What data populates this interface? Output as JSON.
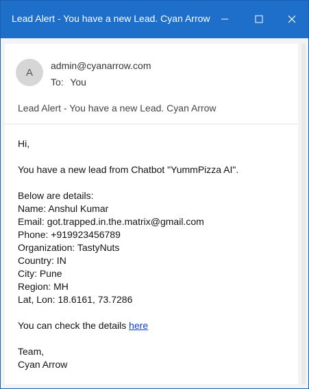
{
  "window": {
    "title": "Lead Alert - You have a new Lead. Cyan Arrow",
    "controls": [
      "minimize-icon",
      "maximize-icon",
      "close-icon"
    ],
    "accent_color": "#1e6fc9"
  },
  "header": {
    "avatar_initial": "A",
    "from": "admin@cyanarrow.com",
    "to_label": "To:",
    "to_value": "You",
    "subject": "Lead Alert - You have a new Lead. Cyan Arrow"
  },
  "body": {
    "greeting": "Hi,",
    "intro": "You have a new lead from Chatbot \"YummPizza AI\".",
    "details_heading": "Below are details:",
    "details": [
      "Name: Anshul Kumar",
      "Email: got.trapped.in.the.matrix@gmail.com",
      "Phone: +919923456789",
      "Organization: TastyNuts",
      "Country: IN",
      "City: Pune",
      "Region: MH",
      "Lat, Lon: 18.6161, 73.7286"
    ],
    "check_text": "You can check the details ",
    "check_link": "here",
    "signoff": "Team,",
    "signature": "Cyan Arrow"
  }
}
